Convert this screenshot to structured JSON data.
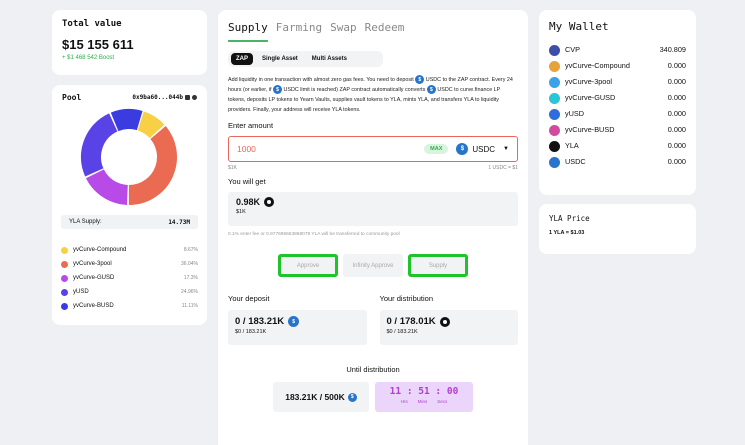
{
  "total": {
    "label": "Total value",
    "value": "$15 155 611",
    "boost": "+ $1 468 542 Boost"
  },
  "pool": {
    "title": "Pool",
    "address": "0x9ba60...044b",
    "yla_supply_label": "YLA Supply:",
    "yla_supply_value": "14.73M",
    "slices": [
      {
        "name": "yvCurve-Compound",
        "pct": "8.67%",
        "value": 8.67,
        "color": "#f7d046"
      },
      {
        "name": "yvCurve-3pool",
        "pct": "36.04%",
        "value": 36.04,
        "color": "#ea6b52"
      },
      {
        "name": "yvCurve-GUSD",
        "pct": "17.3%",
        "value": 17.3,
        "color": "#b84ae8"
      },
      {
        "name": "yUSD",
        "pct": "24.96%",
        "value": 24.96,
        "color": "#5a43e6"
      },
      {
        "name": "yvCurve-BUSD",
        "pct": "11.11%",
        "value": 11.11,
        "color": "#3b3ce0"
      }
    ]
  },
  "tabs": [
    "Supply",
    "Farming",
    "Swap",
    "Redeem"
  ],
  "sub_tabs": [
    "ZAP",
    "Single Asset",
    "Multi Assets"
  ],
  "desc": {
    "p1": "Add liquidity in one transaction with almost zero gas fees. You need to deposit",
    "p2": "USDC to the ZAP contract. Every 24 hours (or earlier, if",
    "p3": "USDC limit is reached) ZAP contract automatically converts",
    "p4": "USDC to curve.finance LP tokens, deposits LP tokens to Yearn Vaults, supplies vault tokens to YLA, mints YLA, and transfers YLA to liquidity providers. Finally, your address will receive YLA tokens."
  },
  "enter_amount": {
    "label": "Enter amount",
    "value": "1000",
    "max": "MAX",
    "token": "USDC",
    "sub_left": "$1K",
    "sub_right": "1 USDC = $1"
  },
  "you_get": {
    "label": "You will get",
    "value": "0.98K",
    "sub": "$1K"
  },
  "fee_note": "0.1% enter fee or 0.977696663868079 YLA will be transferred to community pool",
  "actions": {
    "approve": "Approve",
    "infinity": "Infinity Approve",
    "supply": "Supply"
  },
  "deposit": {
    "label": "Your deposit",
    "value": "0 / 183.21K",
    "sub": "$0 / 183.21K"
  },
  "distribution": {
    "label": "Your distribution",
    "value": "0 / 178.01K",
    "sub": "$0 / 183.21K"
  },
  "until": {
    "label": "Until distribution",
    "cap": "183.21K / 500K",
    "timer": "11 : 51 : 00",
    "units": [
      "Hrs",
      "Mins",
      "Secs"
    ]
  },
  "wallet": {
    "title": "My Wallet",
    "items": [
      {
        "name": "CVP",
        "balance": "340.809",
        "color": "#3d4ea8",
        "icon": "cvp-icon"
      },
      {
        "name": "yvCurve-Compound",
        "balance": "0.000",
        "color": "#e8a23a",
        "icon": "compound-icon"
      },
      {
        "name": "yvCurve-3pool",
        "balance": "0.000",
        "color": "#3aa3e8",
        "icon": "3pool-icon"
      },
      {
        "name": "yvCurve-GUSD",
        "balance": "0.000",
        "color": "#2ac5d6",
        "icon": "gusd-icon"
      },
      {
        "name": "yUSD",
        "balance": "0.000",
        "color": "#2e6de0",
        "icon": "yusd-icon"
      },
      {
        "name": "yvCurve-BUSD",
        "balance": "0.000",
        "color": "#d24aa0",
        "icon": "busd-icon"
      },
      {
        "name": "YLA",
        "balance": "0.000",
        "color": "#111111",
        "icon": "yla-icon"
      },
      {
        "name": "USDC",
        "balance": "0.000",
        "color": "#2775ca",
        "icon": "usdc-icon"
      }
    ]
  },
  "price": {
    "title": "YLA Price",
    "value": "1 YLA = $1.03"
  }
}
